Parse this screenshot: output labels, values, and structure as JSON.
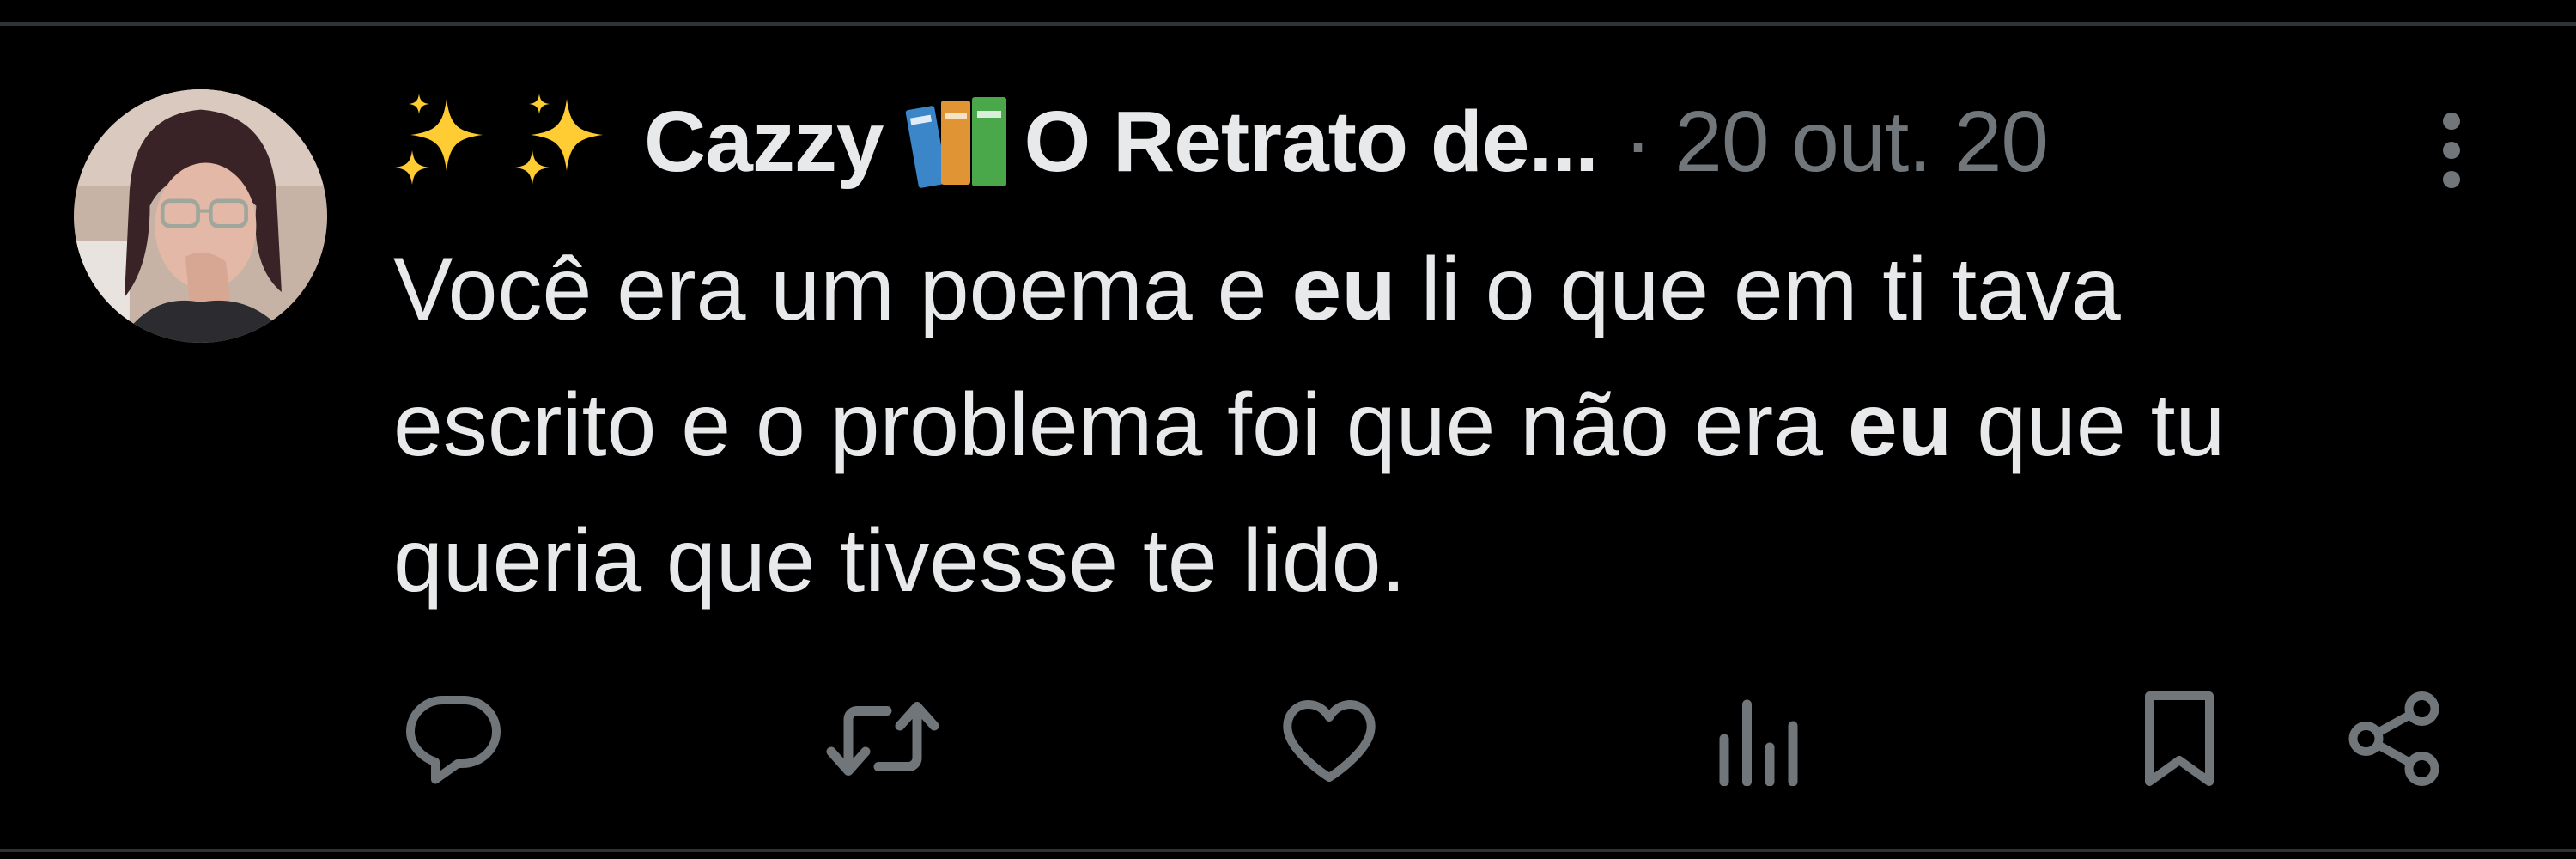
{
  "post": {
    "author": {
      "display_name": "Cazzy",
      "display_name_suffix": "O Retrato de...",
      "emoji_prefix": "sparkles-sparkles",
      "emoji_mid": "books-icon"
    },
    "separator": "·",
    "timestamp": "20 out. 20",
    "text_lines": [
      {
        "before": "Você era um poema e ",
        "bold": "eu",
        "after": " li o que em ti tava"
      },
      {
        "before": "escrito e o problema foi que não era ",
        "bold": "eu",
        "after": " que tu"
      },
      {
        "before": "queria que tivesse te lido.",
        "bold": "",
        "after": ""
      }
    ],
    "actions": [
      {
        "name": "reply",
        "icon": "speech-bubble-icon"
      },
      {
        "name": "repost",
        "icon": "repost-arrows-icon"
      },
      {
        "name": "like",
        "icon": "heart-icon"
      },
      {
        "name": "views",
        "icon": "bar-chart-icon"
      },
      {
        "name": "bookmark",
        "icon": "bookmark-icon"
      },
      {
        "name": "share",
        "icon": "share-nodes-icon"
      }
    ]
  },
  "colors": {
    "background": "#000000",
    "primary_text": "#e7e9ea",
    "secondary_text": "#71767b",
    "divider": "#2f3336",
    "sparkle_yellow": "#ffcc33"
  }
}
